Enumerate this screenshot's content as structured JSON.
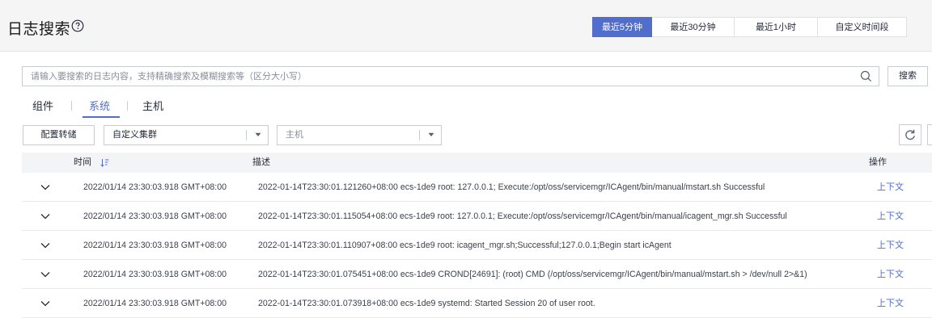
{
  "header": {
    "title": "日志搜索",
    "help_icon": "question-circle-icon",
    "time_ranges": [
      {
        "label": "最近5分钟",
        "active": true
      },
      {
        "label": "最近30分钟",
        "active": false
      },
      {
        "label": "最近1小时",
        "active": false
      },
      {
        "label": "自定义时间段",
        "active": false
      }
    ]
  },
  "search": {
    "placeholder": "请输入要搜索的日志内容，支持精确搜索及模糊搜索等（区分大小写）",
    "value": "",
    "icon": "search-icon",
    "button_label": "搜索"
  },
  "tabs": [
    {
      "label": "组件",
      "active": false
    },
    {
      "label": "系统",
      "active": true
    },
    {
      "label": "主机",
      "active": false
    }
  ],
  "toolbar": {
    "config_label": "配置转储",
    "cluster_select_value": "自定义集群",
    "host_select_placeholder": "主机",
    "refresh_icon": "refresh-icon",
    "export_icon": "export-icon"
  },
  "table": {
    "columns": {
      "time": "时间",
      "desc": "描述",
      "action": "操作"
    },
    "rows": [
      {
        "time": "2022/01/14 23:30:03.918 GMT+08:00",
        "desc": "2022-01-14T23:30:01.121260+08:00 ecs-1de9 root: 127.0.0.1; Execute:/opt/oss/servicemgr/ICAgent/bin/manual/mstart.sh Successful",
        "action": "上下文"
      },
      {
        "time": "2022/01/14 23:30:03.918 GMT+08:00",
        "desc": "2022-01-14T23:30:01.115054+08:00 ecs-1de9 root: 127.0.0.1; Execute:/opt/oss/servicemgr/ICAgent/bin/manual/icagent_mgr.sh Successful",
        "action": "上下文"
      },
      {
        "time": "2022/01/14 23:30:03.918 GMT+08:00",
        "desc": "2022-01-14T23:30:01.110907+08:00 ecs-1de9 root: icagent_mgr.sh;Successful;127.0.0.1;Begin start icAgent",
        "action": "上下文"
      },
      {
        "time": "2022/01/14 23:30:03.918 GMT+08:00",
        "desc": "2022-01-14T23:30:01.075451+08:00 ecs-1de9 CROND[24691]: (root) CMD (/opt/oss/servicemgr/ICAgent/bin/manual/mstart.sh > /dev/null 2>&1)",
        "action": "上下文"
      },
      {
        "time": "2022/01/14 23:30:03.918 GMT+08:00",
        "desc": "2022-01-14T23:30:01.073918+08:00 ecs-1de9 systemd: Started Session 20 of user root.",
        "action": "上下文"
      }
    ]
  },
  "colors": {
    "accent": "#526ecc",
    "header_bg": "#f5f5f6",
    "table_header_bg": "#f3f4f6",
    "border": "#c9ccd4"
  }
}
